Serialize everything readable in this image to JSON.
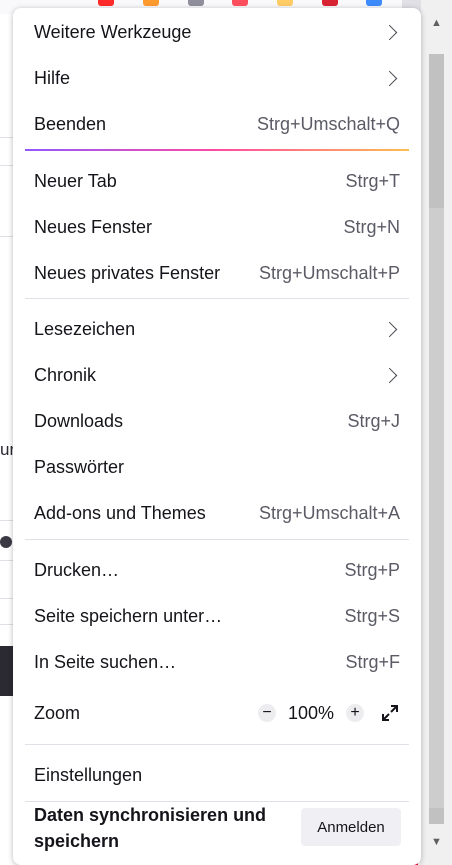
{
  "menu": {
    "groups": [
      [
        {
          "label": "Weitere Werkzeuge",
          "shortcut": "",
          "submenu": true
        },
        {
          "label": "Hilfe",
          "shortcut": "",
          "submenu": true
        },
        {
          "label": "Beenden",
          "shortcut": "Strg+Umschalt+Q",
          "submenu": false
        }
      ],
      [
        {
          "label": "Neuer Tab",
          "shortcut": "Strg+T",
          "submenu": false
        },
        {
          "label": "Neues Fenster",
          "shortcut": "Strg+N",
          "submenu": false
        },
        {
          "label": "Neues privates Fenster",
          "shortcut": "Strg+Umschalt+P",
          "submenu": false
        }
      ],
      [
        {
          "label": "Lesezeichen",
          "shortcut": "",
          "submenu": true
        },
        {
          "label": "Chronik",
          "shortcut": "",
          "submenu": true
        },
        {
          "label": "Downloads",
          "shortcut": "Strg+J",
          "submenu": false
        },
        {
          "label": "Passwörter",
          "shortcut": "",
          "submenu": false
        },
        {
          "label": "Add-ons und Themes",
          "shortcut": "Strg+Umschalt+A",
          "submenu": false
        }
      ],
      [
        {
          "label": "Drucken…",
          "shortcut": "Strg+P",
          "submenu": false
        },
        {
          "label": "Seite speichern unter…",
          "shortcut": "Strg+S",
          "submenu": false
        },
        {
          "label": "In Seite suchen…",
          "shortcut": "Strg+F",
          "submenu": false
        }
      ]
    ],
    "zoom": {
      "label": "Zoom",
      "value": "100%",
      "minus": "−",
      "plus": "+",
      "fullscreen_icon": "fullscreen-icon"
    },
    "settings": "Einstellungen",
    "sync": {
      "label": "Daten synchronisieren und speichern",
      "button": "Anmelden"
    }
  },
  "background": {
    "partial_text": "ur"
  },
  "colors": {
    "accent_gradient": [
      "#9059ff",
      "#ff4aa2",
      "#ffbd4f"
    ],
    "menu_bg": "#ffffff",
    "text": "#15141a",
    "shortcut": "#5b5b66"
  }
}
